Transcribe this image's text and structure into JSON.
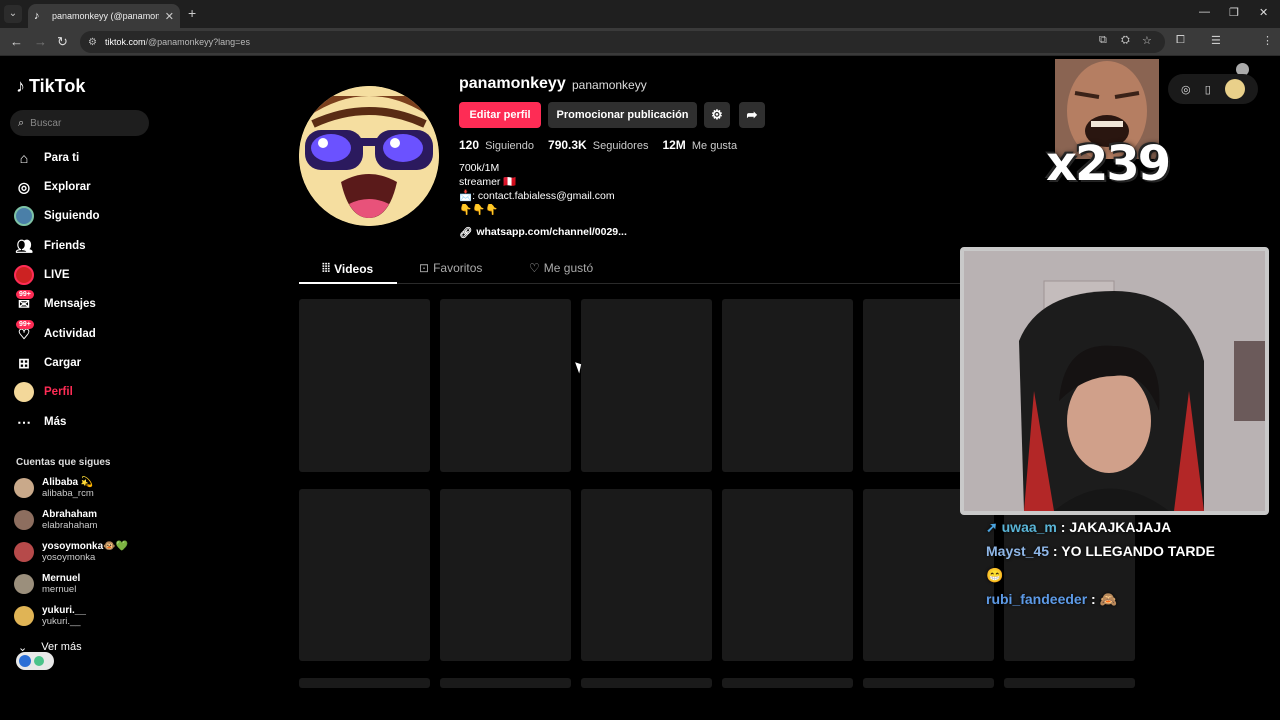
{
  "browser": {
    "tab_title": "panamonkeyy (@panamonkeyy",
    "url_domain": "tiktok.com",
    "url_path": "/@panamonkeyy?lang=es"
  },
  "sidebar": {
    "logo": "TikTok",
    "search_placeholder": "Buscar",
    "items": [
      {
        "label": "Para ti",
        "icon": "home-icon"
      },
      {
        "label": "Explorar",
        "icon": "compass-icon"
      },
      {
        "label": "Siguiendo",
        "icon": "following-avatar-icon"
      },
      {
        "label": "Friends",
        "icon": "friends-icon"
      },
      {
        "label": "LIVE",
        "icon": "live-icon"
      },
      {
        "label": "Mensajes",
        "icon": "messages-icon",
        "badge": "99+"
      },
      {
        "label": "Actividad",
        "icon": "activity-icon",
        "badge": "99+"
      },
      {
        "label": "Cargar",
        "icon": "upload-icon"
      },
      {
        "label": "Perfil",
        "icon": "profile-avatar-icon",
        "active": true
      },
      {
        "label": "Más",
        "icon": "more-icon"
      }
    ],
    "following_title": "Cuentas que sigues",
    "following": [
      {
        "name": "Alibaba 💫",
        "username": "alibaba_rcm"
      },
      {
        "name": "Abrahaham",
        "username": "elabrahaham"
      },
      {
        "name": "yosoymonka🐵💚",
        "username": "yosoymonka"
      },
      {
        "name": "Mernuel",
        "username": "mernuel"
      },
      {
        "name": "yukuri.__",
        "username": "yukuri.__"
      }
    ],
    "ver_mas": "Ver más"
  },
  "profile": {
    "username": "panamonkeyy",
    "nickname": "panamonkeyy",
    "edit_button": "Editar perfil",
    "promote_button": "Promocionar publicación",
    "stats": [
      {
        "value": "120",
        "label": "Siguiendo"
      },
      {
        "value": "790.3K",
        "label": "Seguidores"
      },
      {
        "value": "12M",
        "label": "Me gusta"
      }
    ],
    "bio_lines": [
      "700k/1M",
      "streamer 🇵🇪",
      "📩: contact.fabialess@gmail.com",
      "👇👇👇"
    ],
    "link": "whatsapp.com/channel/0029...",
    "tabs": [
      "Videos",
      "Favoritos",
      "Me gustó"
    ]
  },
  "overlay": {
    "counter": "x239",
    "chat": [
      {
        "user": "uwaa_m",
        "text": "JAKAJKAJAJA"
      },
      {
        "user": "Mayst_45",
        "text": "YO LLEGANDO TARDE 😁"
      },
      {
        "user": "rubi_fandeeder",
        "text": "🙈"
      }
    ]
  },
  "colors": {
    "accent": "#fe2c55",
    "background": "#000000"
  }
}
